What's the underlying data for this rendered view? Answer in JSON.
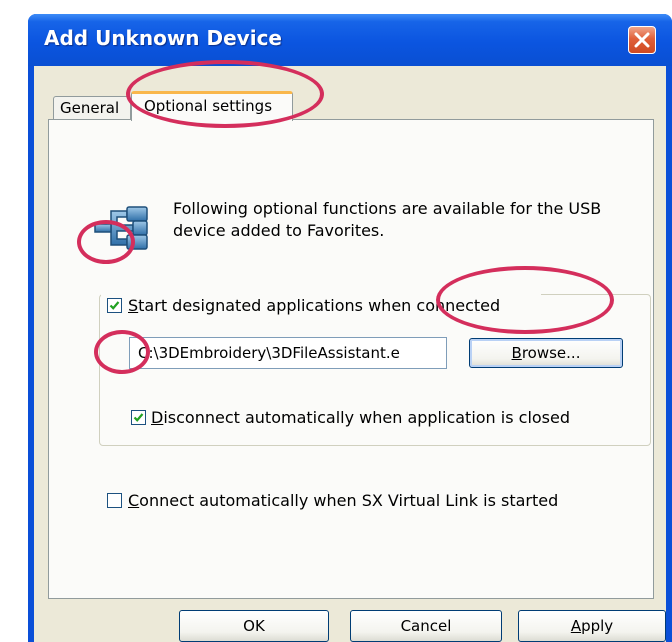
{
  "window": {
    "title": "Add Unknown Device"
  },
  "tabs": [
    {
      "label": "General"
    },
    {
      "label": "Optional settings"
    }
  ],
  "info": {
    "text": "Following optional functions are available for the USB device added to Favorites."
  },
  "start_app": {
    "checked": true,
    "label_first": "S",
    "label_rest": "tart designated applications when connected",
    "path_value": "C:\\3DEmbroidery\\3DFileAssistant.e",
    "browse_first": "B",
    "browse_rest": "rowse..."
  },
  "disconnect": {
    "checked": true,
    "label_first": "D",
    "label_rest": "isconnect automatically when application is closed"
  },
  "connect_auto": {
    "checked": false,
    "label_first": "C",
    "label_rest": "onnect automatically when SX Virtual Link is started"
  },
  "buttons": {
    "ok": "OK",
    "cancel": "Cancel",
    "apply_first": "A",
    "apply_rest": "pply"
  },
  "colors": {
    "titlebar": "#0b55e0",
    "highlight_ring": "#d42e5c",
    "check_mark": "#21a121"
  },
  "icons": [
    "close-icon",
    "usb-device-icon",
    "check-icon"
  ]
}
